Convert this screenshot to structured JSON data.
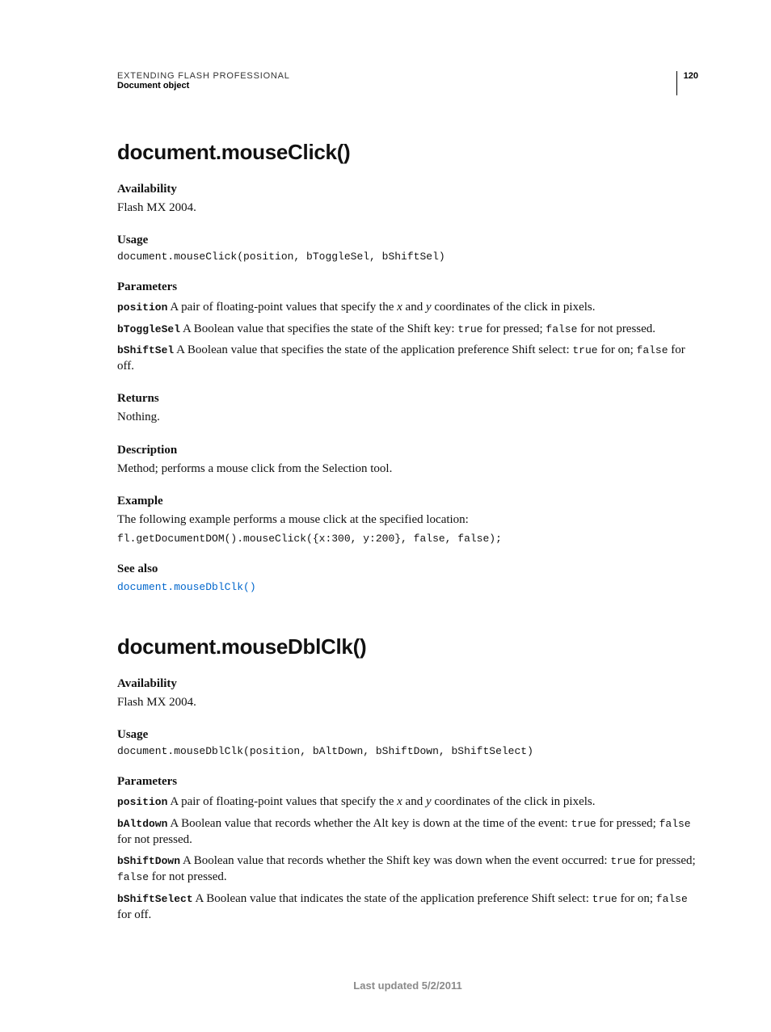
{
  "header": {
    "running_head": "EXTENDING FLASH PROFESSIONAL",
    "section": "Document object",
    "page_number": "120"
  },
  "sections": [
    {
      "title": "document.mouseClick()",
      "availability": {
        "label": "Availability",
        "text": "Flash MX 2004."
      },
      "usage": {
        "label": "Usage",
        "code": "document.mouseClick(position, bToggleSel, bShiftSel)"
      },
      "parameters": {
        "label": "Parameters",
        "items": [
          {
            "name": "position",
            "pre": "  A pair of floating-point values that specify the ",
            "i1": "x",
            "mid": " and ",
            "i2": "y",
            "post": " coordinates of the click in pixels."
          },
          {
            "name": "bToggleSel",
            "pre": "  A Boolean value that specifies the state of the Shift key: ",
            "c1": "true",
            "mid": " for pressed; ",
            "c2": "false",
            "post": " for not pressed."
          },
          {
            "name": "bShiftSel",
            "pre": "  A Boolean value that specifies the state of the application preference Shift select: ",
            "c1": "true",
            "mid": " for on; ",
            "c2": "false",
            "post": " for off."
          }
        ]
      },
      "returns": {
        "label": "Returns",
        "text": "Nothing."
      },
      "description": {
        "label": "Description",
        "text": "Method; performs a mouse click from the Selection tool."
      },
      "example": {
        "label": "Example",
        "text": "The following example performs a mouse click at the specified location:",
        "code": "fl.getDocumentDOM().mouseClick({x:300, y:200}, false, false);"
      },
      "see_also": {
        "label": "See also",
        "link": "document.mouseDblClk()"
      }
    },
    {
      "title": "document.mouseDblClk()",
      "availability": {
        "label": "Availability",
        "text": "Flash MX 2004."
      },
      "usage": {
        "label": "Usage",
        "code": "document.mouseDblClk(position, bAltDown, bShiftDown, bShiftSelect)"
      },
      "parameters": {
        "label": "Parameters",
        "items": [
          {
            "name": "position",
            "pre": "  A pair of floating-point values that specify the ",
            "i1": "x",
            "mid": " and ",
            "i2": "y",
            "post": " coordinates of the click in pixels."
          },
          {
            "name": "bAltdown",
            "pre": "  A Boolean value that records whether the Alt key is down at the time of the event: ",
            "c1": "true",
            "mid": " for pressed; ",
            "c2": "false",
            "post": " for not pressed."
          },
          {
            "name": "bShiftDown",
            "pre": "  A Boolean value that records whether the Shift key was down when the event occurred: ",
            "c1": "true",
            "mid": " for pressed; ",
            "c2": "false",
            "post": " for not pressed."
          },
          {
            "name": "bShiftSelect",
            "pre": "  A Boolean value that indicates the state of the application preference Shift select: ",
            "c1": "true",
            "mid": " for on; ",
            "c2": "false",
            "post": " for off."
          }
        ]
      }
    }
  ],
  "footer": "Last updated 5/2/2011"
}
